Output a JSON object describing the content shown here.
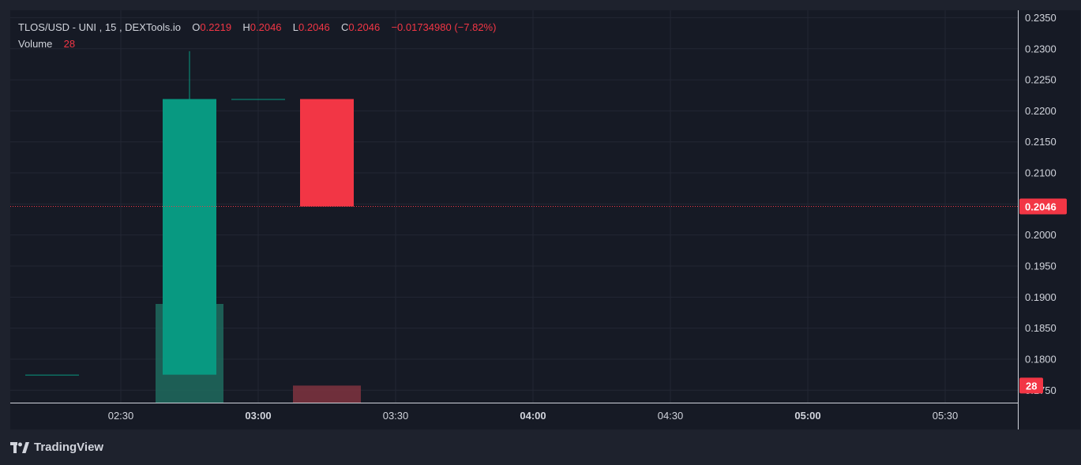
{
  "legend": {
    "symbol": "TLOS/USD",
    "exchange": "UNI",
    "interval": "15",
    "source": "DEXTools.io",
    "o_label": "O",
    "o_value": "0.2219",
    "h_label": "H",
    "h_value": "0.2046",
    "l_label": "L",
    "l_value": "0.2046",
    "c_label": "C",
    "c_value": "0.2046",
    "change": "−0.01734980 (−7.82%)",
    "volume_label": "Volume",
    "volume_value": "28"
  },
  "branding": {
    "name": "TradingView",
    "logo_icon": "tradingview-logo-icon"
  },
  "colors": {
    "up": "#089981",
    "down": "#f23645",
    "volume_up": "#1f6b5e",
    "volume_down": "#7f3440",
    "grid": "#232734",
    "background": "#161a25",
    "axis_text": "#d1d4dc"
  },
  "chart_data": {
    "type": "candlestick",
    "title": "TLOS/USD · UNI, 15, DEXTools.io",
    "x_ticks": [
      {
        "label": "02:30",
        "bold": false
      },
      {
        "label": "03:00",
        "bold": true
      },
      {
        "label": "03:30",
        "bold": false
      },
      {
        "label": "04:00",
        "bold": true
      },
      {
        "label": "04:30",
        "bold": false
      },
      {
        "label": "05:00",
        "bold": true
      },
      {
        "label": "05:30",
        "bold": false
      }
    ],
    "y_ticks": [
      "0.1750",
      "0.1800",
      "0.1850",
      "0.1900",
      "0.1950",
      "0.2000",
      "0.2050",
      "0.2100",
      "0.2150",
      "0.2200",
      "0.2250",
      "0.2300",
      "0.2350"
    ],
    "ylim": [
      0.173,
      0.2362
    ],
    "candles": [
      {
        "time": "02:00",
        "open": 0.1775,
        "high": 0.1775,
        "low": 0.1775,
        "close": 0.1775,
        "volume": 0
      },
      {
        "time": "02:15",
        "open": 0.1775,
        "high": 0.1775,
        "low": 0.1775,
        "close": 0.1775,
        "volume": 0
      },
      {
        "time": "02:45",
        "open": 0.1775,
        "high": 0.2296,
        "low": 0.1775,
        "close": 0.2219,
        "volume": 162
      },
      {
        "time": "03:00",
        "open": 0.2219,
        "high": 0.2219,
        "low": 0.2219,
        "close": 0.2219,
        "volume": 0
      },
      {
        "time": "03:15",
        "open": 0.2219,
        "high": 0.2219,
        "low": 0.2046,
        "close": 0.2046,
        "volume": 28
      }
    ],
    "volume_max": 162,
    "last_price": "0.2046",
    "last_volume": "28"
  }
}
